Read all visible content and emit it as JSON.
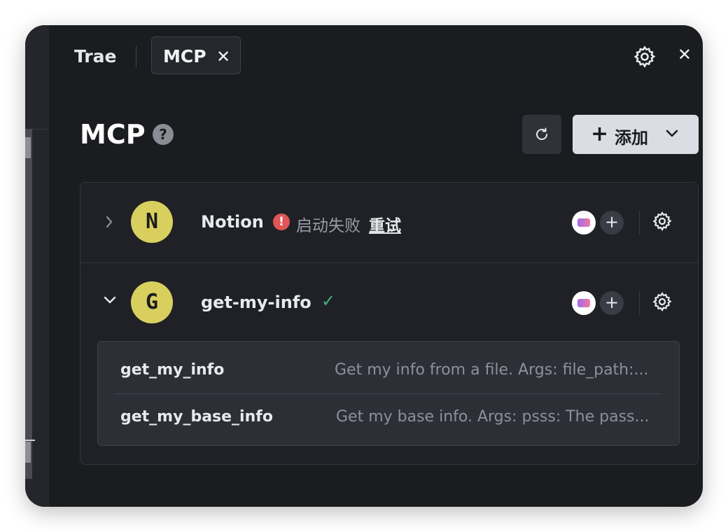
{
  "tabs": {
    "trae": "Trae",
    "mcp": "MCP",
    "close_glyph": "✕"
  },
  "window_close": "✕",
  "header": {
    "title": "MCP",
    "help_glyph": "?",
    "add_button": {
      "plus": "+",
      "label": "添加"
    }
  },
  "servers": [
    {
      "avatar": "N",
      "name": "Notion",
      "status": "error",
      "status_text": "启动失败",
      "retry_label": "重试",
      "expanded": false
    },
    {
      "avatar": "G",
      "name": "get-my-info",
      "status": "ok",
      "status_glyph": "✓",
      "expanded": true
    }
  ],
  "server_actions": {
    "add_glyph": "+"
  },
  "tools": [
    {
      "name": "get_my_info",
      "description": "Get my info from a file. Args: file_path:..."
    },
    {
      "name": "get_my_base_info",
      "description": "Get my base info. Args: psss: The pass..."
    }
  ],
  "colors": {
    "background": "#1b1c20",
    "accent_avatar": "#d9cf5e",
    "error": "#e05555",
    "ok": "#3fb27f"
  }
}
